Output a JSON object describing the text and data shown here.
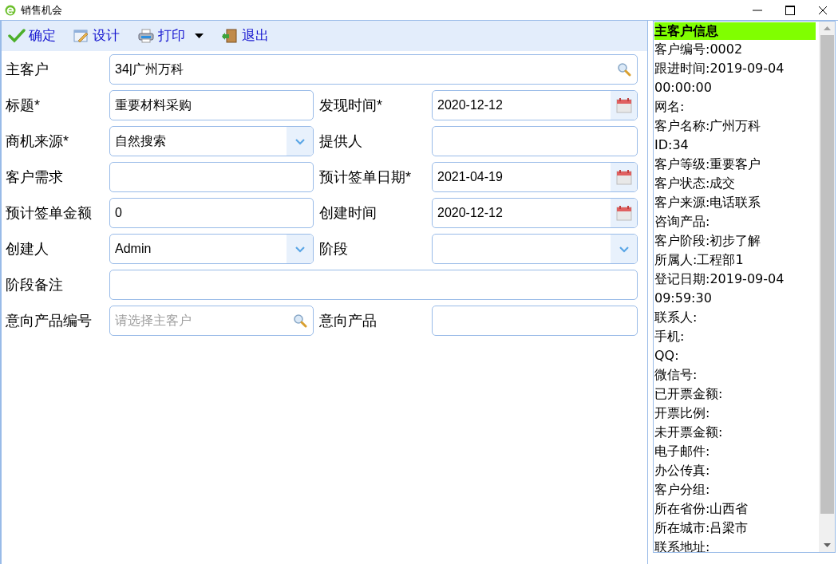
{
  "window": {
    "title": "销售机会"
  },
  "toolbar": [
    {
      "kind": "check",
      "label": "确定"
    },
    {
      "kind": "design",
      "label": "设计"
    },
    {
      "kind": "print",
      "label": "打印",
      "dropdown": true
    },
    {
      "kind": "exit",
      "label": "退出"
    }
  ],
  "form": [
    [
      {
        "label": "主客户",
        "kind": "lookup",
        "value": "34|广州万科",
        "wide": true
      }
    ],
    [
      {
        "label": "标题*",
        "kind": "text",
        "value": "重要材料采购"
      },
      {
        "label": "发现时间*",
        "kind": "date",
        "value": "2020-12-12"
      }
    ],
    [
      {
        "label": "商机来源*",
        "kind": "select",
        "value": "自然搜索"
      },
      {
        "label": "提供人",
        "kind": "text"
      }
    ],
    [
      {
        "label": "客户需求",
        "kind": "text"
      },
      {
        "label": "预计签单日期*",
        "kind": "date",
        "value": "2021-04-19"
      }
    ],
    [
      {
        "label": "预计签单金额",
        "kind": "text",
        "value": "0"
      },
      {
        "label": "创建时间",
        "kind": "date",
        "value": "2020-12-12"
      }
    ],
    [
      {
        "label": "创建人",
        "kind": "select",
        "value": "Admin"
      },
      {
        "label": "阶段",
        "kind": "select"
      }
    ],
    [
      {
        "label": "阶段备注",
        "kind": "text",
        "wide": true
      }
    ],
    [
      {
        "label": "意向产品编号",
        "kind": "lookup",
        "placeholder": "请选择主客户"
      },
      {
        "label": "意向产品",
        "kind": "text"
      }
    ]
  ],
  "customer_info": {
    "title": "主客户信息",
    "lines": [
      "客户编号:0002",
      "跟进时间:2019-09-04 00:00:00",
      "网名:",
      "客户名称:广州万科",
      "ID:34",
      "客户等级:重要客户",
      "客户状态:成交",
      "客户来源:电话联系",
      "咨询产品:",
      "客户阶段:初步了解",
      "所属人:工程部1",
      "登记日期:2019-09-04 09:59:30",
      "联系人:",
      "手机:",
      "QQ:",
      "微信号:",
      "已开票金额:",
      "开票比例:",
      "未开票金额:",
      "电子邮件:",
      "办公传真:",
      "客户分组:",
      "所在省份:山西省",
      "所在城市:吕梁市",
      "联系地址:"
    ]
  }
}
